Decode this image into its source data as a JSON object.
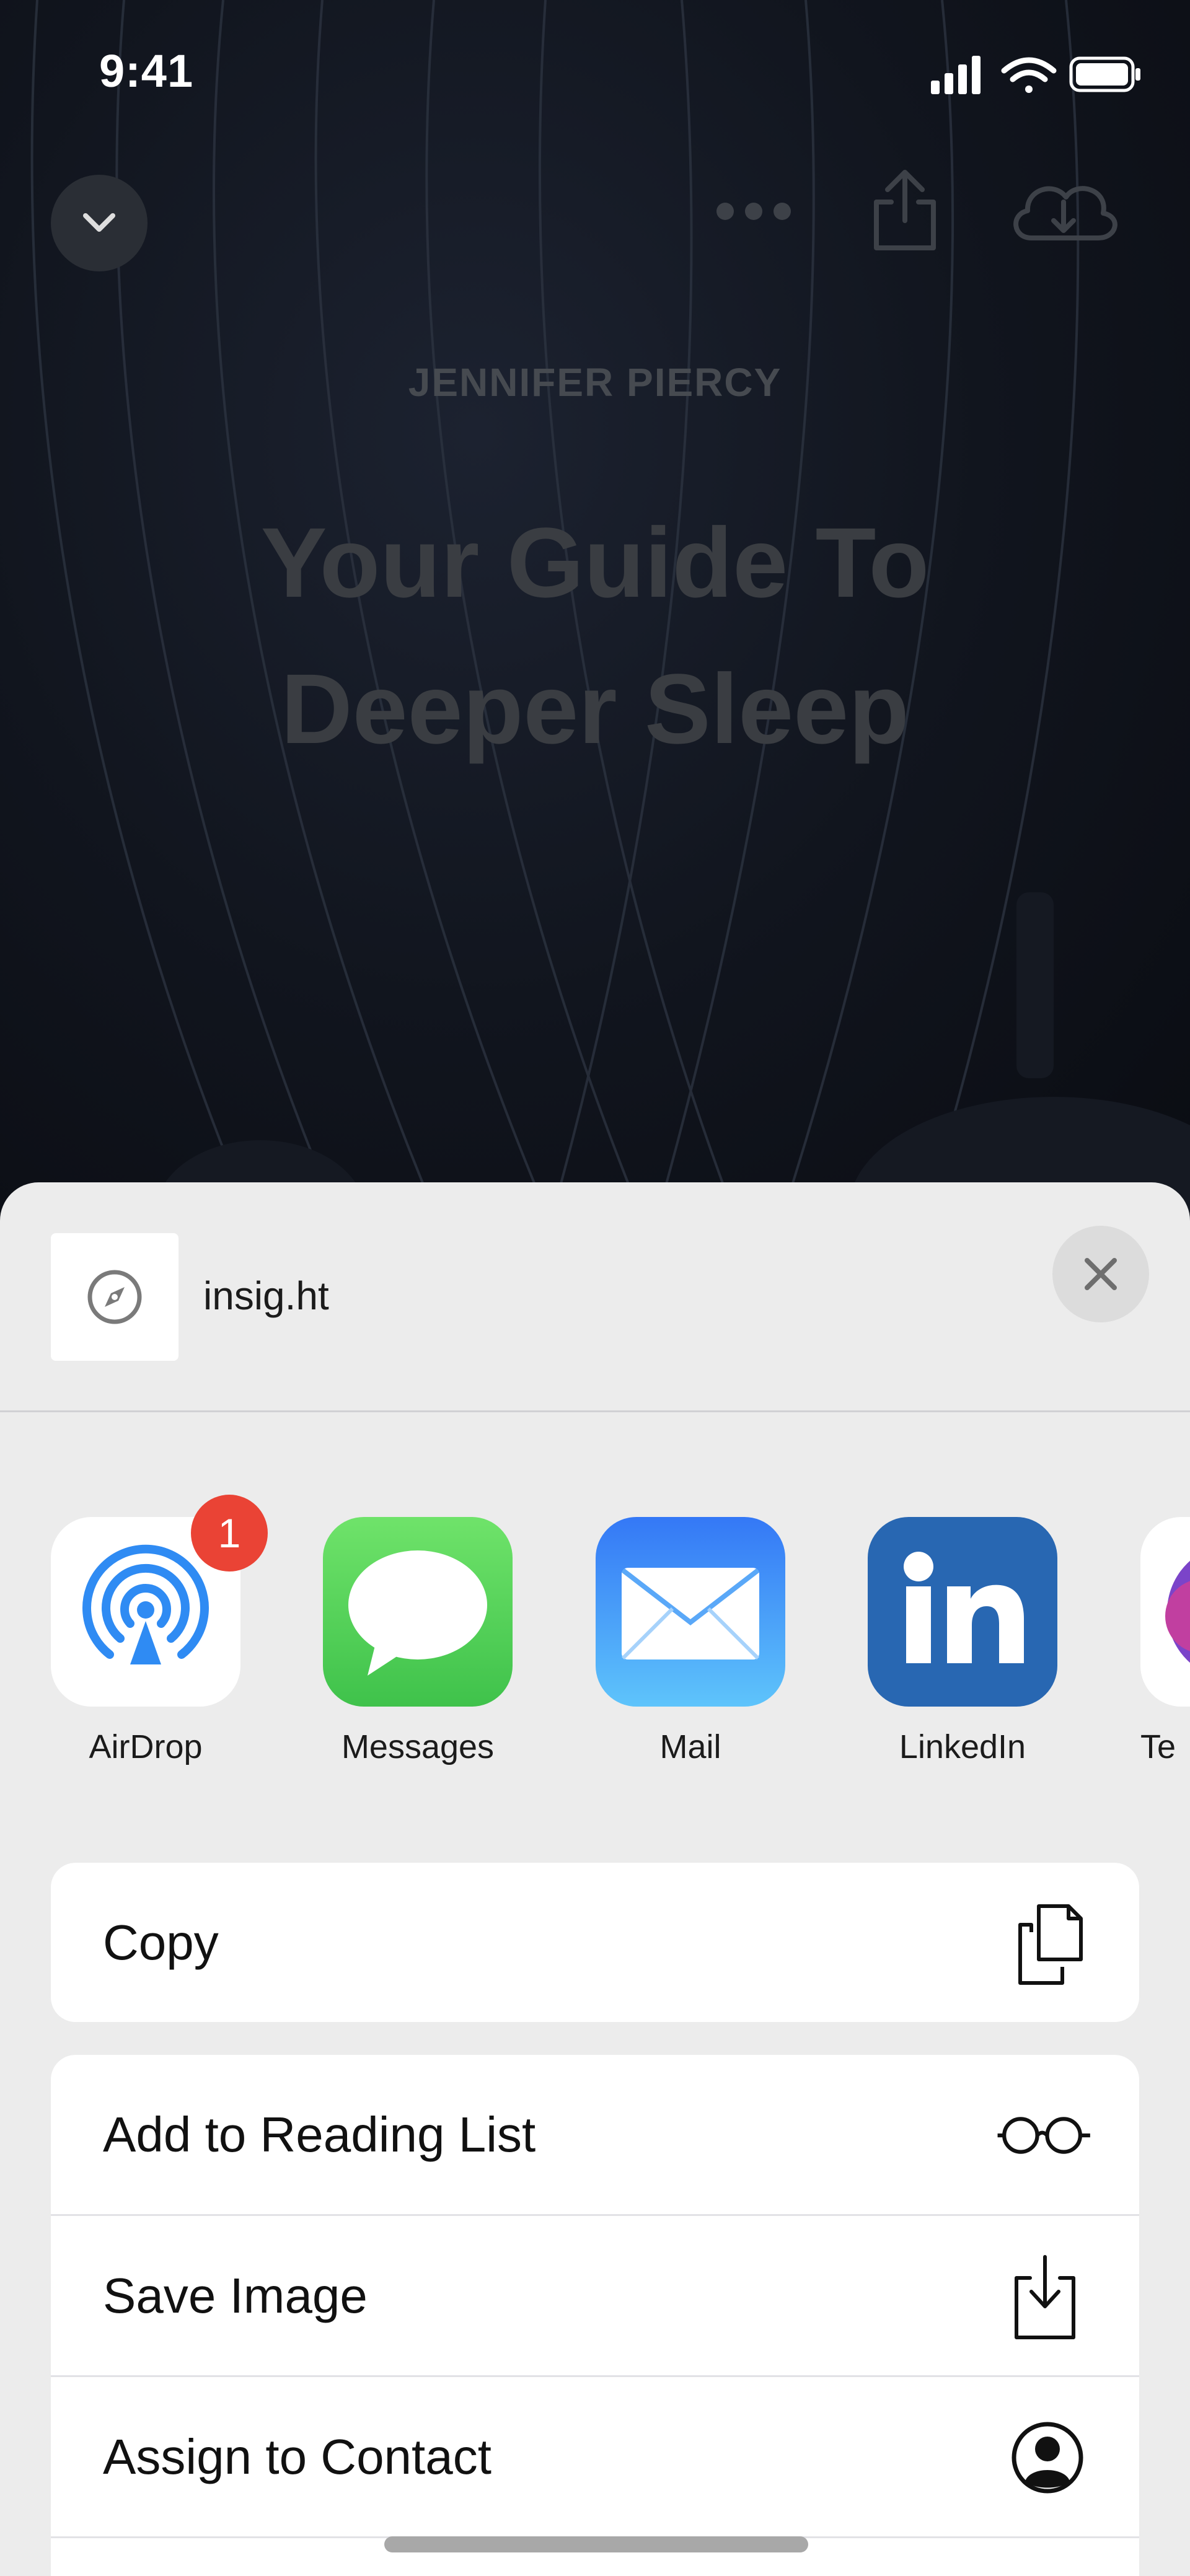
{
  "status_bar": {
    "time": "9:41"
  },
  "player": {
    "author": "JENNIFER PIERCY",
    "title_lines": [
      "Your Guide To",
      "Deeper Sleep"
    ]
  },
  "share_sheet": {
    "url": "insig.ht",
    "apps": [
      {
        "label": "AirDrop",
        "icon": "airdrop-icon",
        "badge": "1",
        "color": "#2f8bf3"
      },
      {
        "label": "Messages",
        "icon": "messages-icon",
        "color": "#4cd964"
      },
      {
        "label": "Mail",
        "icon": "mail-icon",
        "color": "#3e8ef7"
      },
      {
        "label": "LinkedIn",
        "icon": "linkedin-icon",
        "color": "#2867b2"
      },
      {
        "label": "Te",
        "icon": "teams-icon",
        "color": "#7b44c9"
      }
    ],
    "actions_group1": [
      {
        "label": "Copy",
        "icon": "copy-icon"
      }
    ],
    "actions_group2": [
      {
        "label": "Add to Reading List",
        "icon": "glasses-icon"
      },
      {
        "label": "Save Image",
        "icon": "save-image-icon"
      },
      {
        "label": "Assign to Contact",
        "icon": "contact-icon"
      }
    ]
  }
}
